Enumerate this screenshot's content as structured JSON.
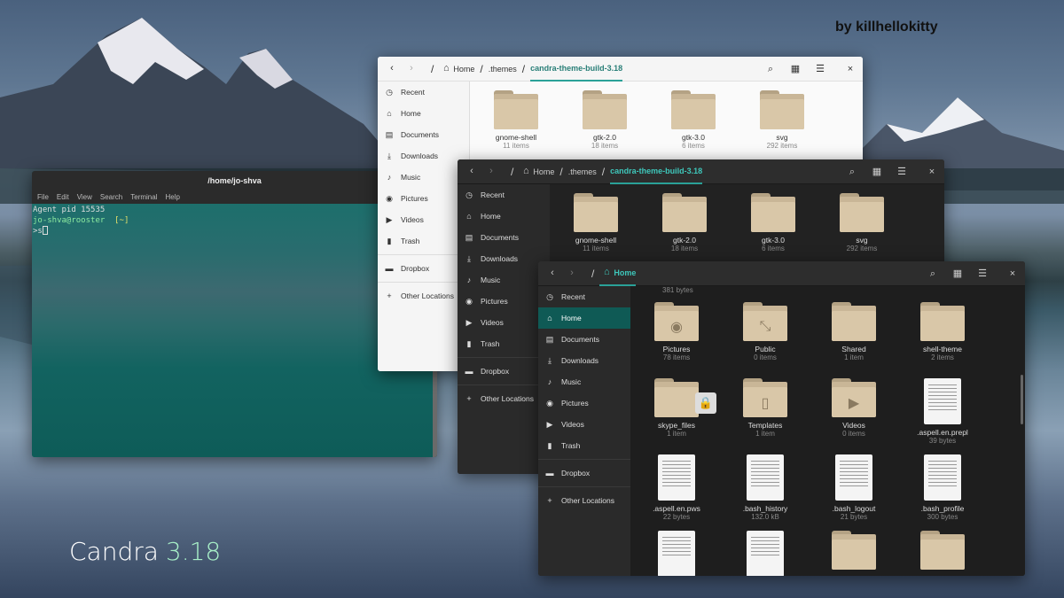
{
  "credit": "by killhellokitty",
  "brand": {
    "name": "Candra",
    "version": "3.18"
  },
  "terminal": {
    "title": "/home/jo-shva",
    "menu": [
      "File",
      "Edit",
      "View",
      "Search",
      "Terminal",
      "Help"
    ],
    "lines": [
      "Agent pid 15535",
      "jo-shva@rooster",
      "[~]",
      ">s"
    ]
  },
  "sidebar": {
    "items": [
      "Recent",
      "Home",
      "Documents",
      "Downloads",
      "Music",
      "Pictures",
      "Videos",
      "Trash"
    ],
    "extra": [
      "Dropbox",
      "Other Locations"
    ]
  },
  "theme_window": {
    "path": [
      "Home",
      ".themes",
      "candra-theme-build-3.18"
    ],
    "folders": [
      {
        "name": "gnome-shell",
        "count": "11 items"
      },
      {
        "name": "gtk-2.0",
        "count": "18 items"
      },
      {
        "name": "gtk-3.0",
        "count": "6 items"
      },
      {
        "name": "svg",
        "count": "292 items"
      }
    ]
  },
  "home_window": {
    "path": [
      "Home"
    ],
    "top_caption": "381 bytes",
    "rows": [
      [
        {
          "name": "Pictures",
          "count": "78 items",
          "kind": "folder",
          "emblem": "camera-icon"
        },
        {
          "name": "Public",
          "count": "0 items",
          "kind": "folder",
          "emblem": "share-icon"
        },
        {
          "name": "Shared",
          "count": "1 item",
          "kind": "folder",
          "emblem": ""
        },
        {
          "name": "shell-theme",
          "count": "2 items",
          "kind": "folder",
          "emblem": ""
        }
      ],
      [
        {
          "name": "skype_files",
          "count": "1 item",
          "kind": "folder",
          "emblem": "link-lock-icon"
        },
        {
          "name": "Templates",
          "count": "1 item",
          "kind": "folder",
          "emblem": "template-icon"
        },
        {
          "name": "Videos",
          "count": "0 items",
          "kind": "folder",
          "emblem": "video-icon"
        },
        {
          "name": ".aspell.en.prepl",
          "count": "39 bytes",
          "kind": "doc",
          "emblem": ""
        }
      ],
      [
        {
          "name": ".aspell.en.pws",
          "count": "22 bytes",
          "kind": "doc",
          "emblem": ""
        },
        {
          "name": ".bash_history",
          "count": "132.0 kB",
          "kind": "doc",
          "emblem": ""
        },
        {
          "name": ".bash_logout",
          "count": "21 bytes",
          "kind": "doc",
          "emblem": ""
        },
        {
          "name": ".bash_profile",
          "count": "300 bytes",
          "kind": "doc",
          "emblem": ""
        }
      ]
    ]
  },
  "icons": {
    "back": "chevron-left-icon",
    "forward": "chevron-right-icon",
    "search": "search-icon",
    "view": "grid-view-icon",
    "menu": "hamburger-menu-icon",
    "close": "close-icon"
  }
}
